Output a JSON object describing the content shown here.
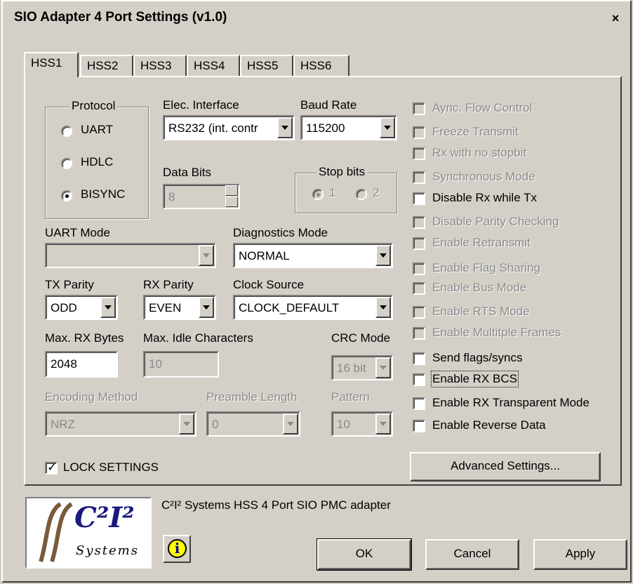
{
  "window": {
    "title": "SIO Adapter 4 Port Settings (v1.0)",
    "close_glyph": "×"
  },
  "tabs": [
    "HSS1",
    "HSS2",
    "HSS3",
    "HSS4",
    "HSS5",
    "HSS6"
  ],
  "active_tab": "HSS1",
  "protocol": {
    "legend": "Protocol",
    "options": [
      "UART",
      "HDLC",
      "BISYNC"
    ],
    "selected": "BISYNC"
  },
  "elec_interface": {
    "label": "Elec. Interface",
    "value": "RS232 (int. contr"
  },
  "baud_rate": {
    "label": "Baud Rate",
    "value": "115200"
  },
  "data_bits": {
    "label": "Data Bits",
    "value": "8"
  },
  "stop_bits": {
    "legend": "Stop bits",
    "options": [
      "1",
      "2"
    ],
    "selected": "1"
  },
  "uart_mode": {
    "label": "UART Mode",
    "value": ""
  },
  "diagnostics_mode": {
    "label": "Diagnostics Mode",
    "value": "NORMAL"
  },
  "tx_parity": {
    "label": "TX Parity",
    "value": "ODD"
  },
  "rx_parity": {
    "label": "RX Parity",
    "value": "EVEN"
  },
  "clock_source": {
    "label": "Clock Source",
    "value": "CLOCK_DEFAULT"
  },
  "max_rx_bytes": {
    "label": "Max. RX Bytes",
    "value": "2048"
  },
  "max_idle_chars": {
    "label": "Max. Idle Characters",
    "value": "10"
  },
  "crc_mode": {
    "label": "CRC Mode",
    "value": "16 bit"
  },
  "encoding_method": {
    "label": "Encoding Method",
    "value": "NRZ"
  },
  "preamble_length": {
    "label": "Preamble Length",
    "value": "0"
  },
  "pattern": {
    "label": "Pattern",
    "value": "10"
  },
  "options": [
    {
      "label": "Aync. Flow Control",
      "enabled": false,
      "checked": false
    },
    {
      "label": "Freeze Transmit",
      "enabled": false,
      "checked": false
    },
    {
      "label": "Rx with no stopbit",
      "enabled": false,
      "checked": false
    },
    {
      "label": "Synchronous Mode",
      "enabled": false,
      "checked": false
    },
    {
      "label": "Disable Rx while Tx",
      "enabled": true,
      "checked": false
    },
    {
      "label": "Disable Parity Checking",
      "enabled": false,
      "checked": false
    },
    {
      "label": "Enable Retransmit",
      "enabled": false,
      "checked": false
    },
    {
      "label": "Enable Flag Sharing",
      "enabled": false,
      "checked": false
    },
    {
      "label": "Enable Bus Mode",
      "enabled": false,
      "checked": false
    },
    {
      "label": "Enable RTS Mode",
      "enabled": false,
      "checked": false
    },
    {
      "label": "Enable Multitple Frames",
      "enabled": false,
      "checked": false
    },
    {
      "label": "Send flags/syncs",
      "enabled": true,
      "checked": false
    },
    {
      "label": "Enable RX BCS",
      "enabled": true,
      "checked": false
    },
    {
      "label": "Enable RX Transparent Mode",
      "enabled": true,
      "checked": false
    },
    {
      "label": "Enable Reverse Data",
      "enabled": true,
      "checked": false
    }
  ],
  "lock_settings": {
    "label": "LOCK SETTINGS",
    "checked": true
  },
  "advanced_button": "Advanced Settings...",
  "footer": {
    "description": "C²I² Systems HSS 4 Port SIO PMC adapter",
    "logo_main": "C²I²",
    "logo_sub": "Systems",
    "info_glyph": "i",
    "ok": "OK",
    "cancel": "Cancel",
    "apply": "Apply"
  }
}
